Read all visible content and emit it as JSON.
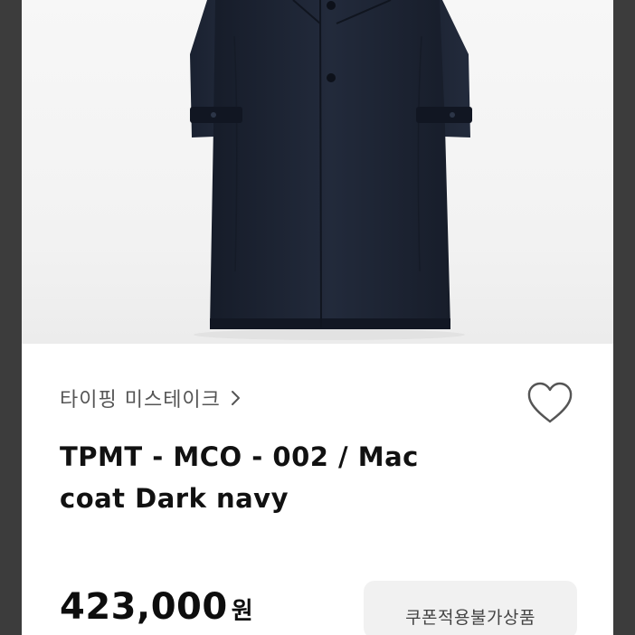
{
  "product": {
    "image_alt": "dark navy mac coat",
    "brand_label": "타이핑 미스테이크",
    "chevron_icon": "chevron-right-icon",
    "wishlist_icon": "heart-outline-icon",
    "title": "TPMT - MCO - 002 / Mac coat Dark navy",
    "price_value": "423,000",
    "price_unit": "원",
    "coupon_label": "쿠폰적용불가상품"
  },
  "colors": {
    "background": "#ffffff",
    "frame": "#3c3c3c",
    "coat": "#1c2333",
    "text_primary": "#111111",
    "text_secondary": "#555555",
    "badge_bg": "#f1f1f1"
  }
}
